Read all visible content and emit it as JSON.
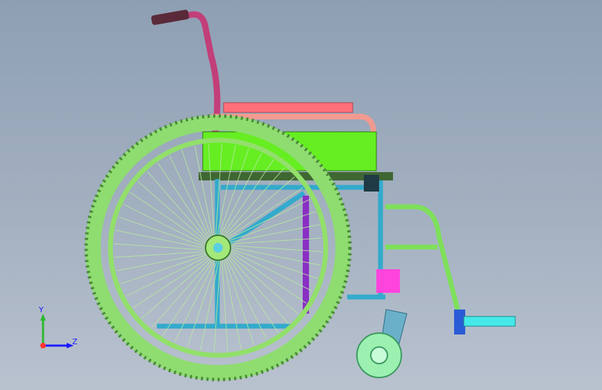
{
  "viewport": {
    "background_top": "#8e9fb4",
    "background_bottom": "#b9c2cf"
  },
  "colors": {
    "handle": "#c23f7a",
    "grip": "#5a2a3a",
    "armrest_pad": "#ff6f7a",
    "armrest_tube": "#f29a90",
    "seat": "#66ee22",
    "frame": "#33aacc",
    "brace": "#8a2fc4",
    "tire": "#8fdc70",
    "handrim": "#92e06a",
    "spoke": "#b8e8a0",
    "hub": "#5bd0e0",
    "legrest": "#7ee05a",
    "footplate": "#45e8e8",
    "caster_fork": "#6ab0c8",
    "caster_wheel": "#9cf0b0",
    "caster_block": "#ff44dd"
  },
  "triad": {
    "y_label": "Y",
    "z_label": "Z"
  }
}
